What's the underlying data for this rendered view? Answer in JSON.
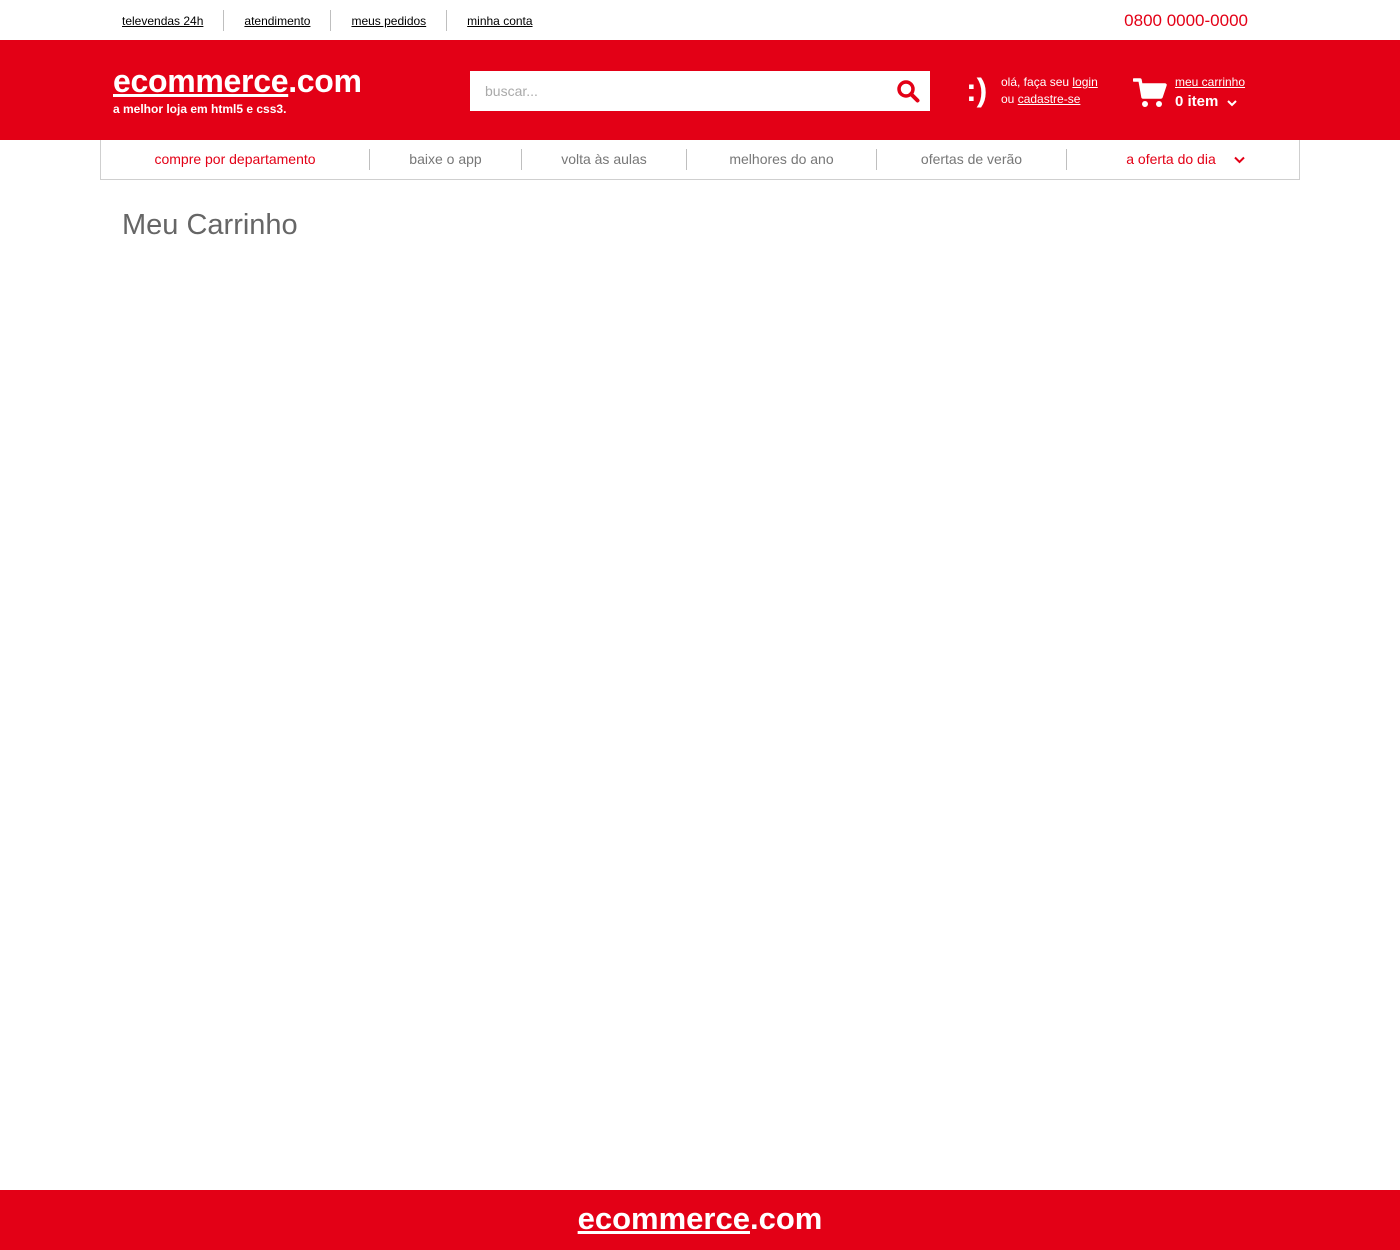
{
  "topbar": {
    "links": [
      "televendas 24h",
      "atendimento",
      "meus pedidos",
      "minha conta"
    ],
    "phone": "0800 0000-0000"
  },
  "header": {
    "logo_main": "ecommerce",
    "logo_suffix": ".com",
    "tagline": "a melhor loja em html5 e css3.",
    "search_placeholder": "buscar...",
    "smiley": ":)",
    "greeting_prefix": "olá, faça seu",
    "login_link": "login",
    "or_text": "ou",
    "signup_link": "cadastre-se",
    "cart_label": "meu carrinho",
    "cart_count": "0 item"
  },
  "nav": {
    "items": [
      "compre por departamento",
      "baixe o app",
      "volta às aulas",
      "melhores do ano",
      "ofertas de verão",
      "a oferta do dia"
    ]
  },
  "main": {
    "title": "Meu Carrinho"
  },
  "footer": {
    "logo_main": "ecommerce",
    "logo_suffix": ".com"
  },
  "colors": {
    "brand_red": "#e30016",
    "nav_gray": "#777777",
    "title_gray": "#666666"
  },
  "icons": [
    "search-icon",
    "cart-icon",
    "chevron-down-icon"
  ]
}
